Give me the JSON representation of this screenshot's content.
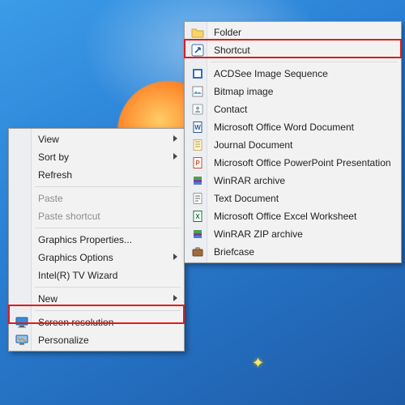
{
  "context_menu": {
    "items": [
      {
        "label": "View"
      },
      {
        "label": "Sort by"
      },
      {
        "label": "Refresh"
      },
      {
        "label": "Paste"
      },
      {
        "label": "Paste shortcut"
      },
      {
        "label": "Graphics Properties..."
      },
      {
        "label": "Graphics Options"
      },
      {
        "label": "Intel(R) TV Wizard"
      },
      {
        "label": "New"
      },
      {
        "label": "Screen resolution"
      },
      {
        "label": "Personalize"
      }
    ]
  },
  "new_submenu": {
    "items": [
      {
        "label": "Folder"
      },
      {
        "label": "Shortcut"
      },
      {
        "label": "ACDSee Image Sequence"
      },
      {
        "label": "Bitmap image"
      },
      {
        "label": "Contact"
      },
      {
        "label": "Microsoft Office Word Document"
      },
      {
        "label": "Journal Document"
      },
      {
        "label": "Microsoft Office PowerPoint Presentation"
      },
      {
        "label": "WinRAR archive"
      },
      {
        "label": "Text Document"
      },
      {
        "label": "Microsoft Office Excel Worksheet"
      },
      {
        "label": "WinRAR ZIP archive"
      },
      {
        "label": "Briefcase"
      }
    ]
  }
}
